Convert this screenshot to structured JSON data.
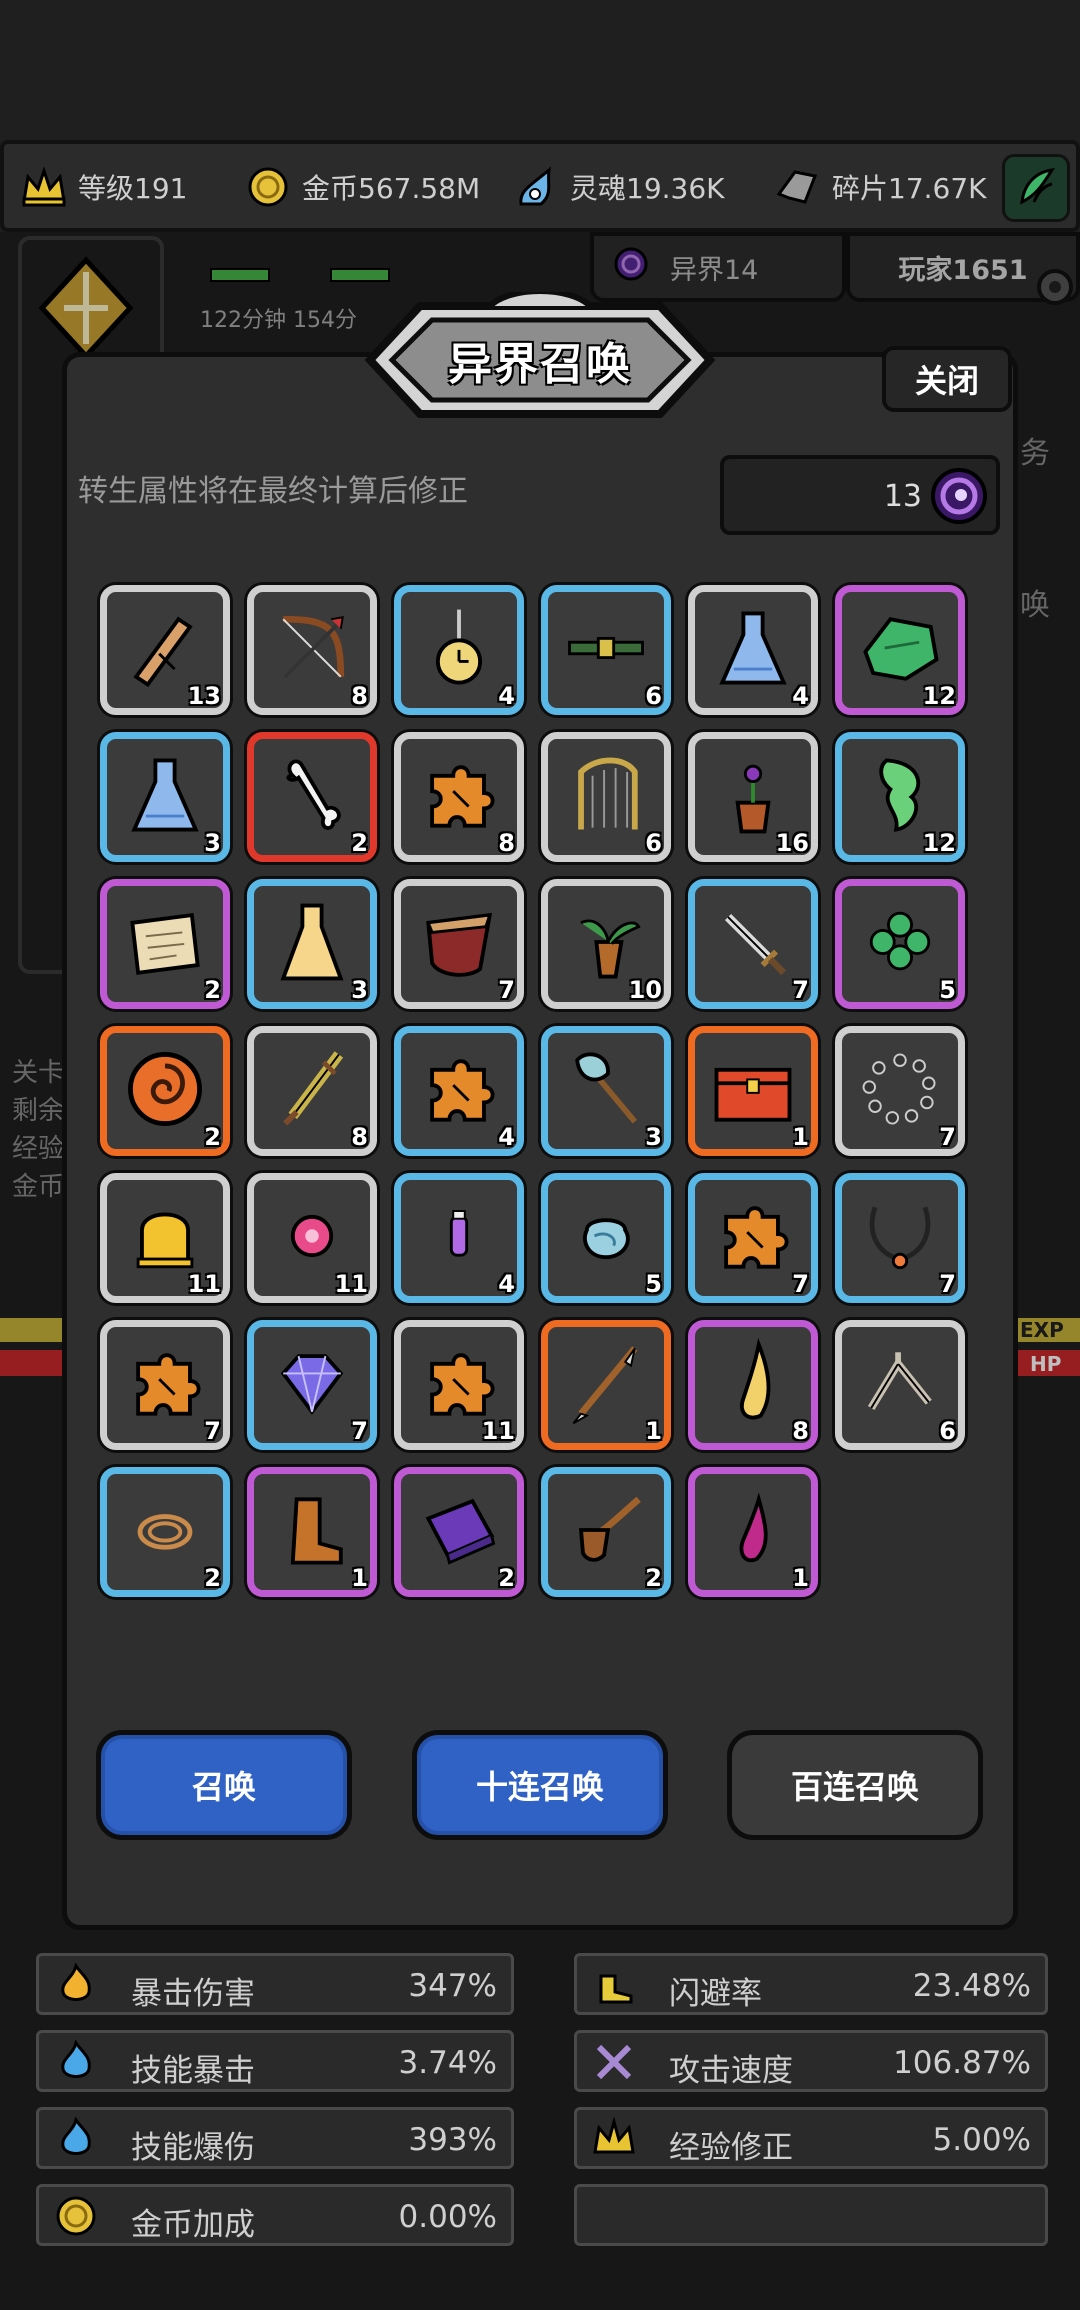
{
  "resources": [
    {
      "icon": "crown-icon",
      "label": "等级191"
    },
    {
      "icon": "coin-icon",
      "label": "金币567.58M"
    },
    {
      "icon": "soul-flame-icon",
      "label": "灵魂19.36K"
    },
    {
      "icon": "shard-icon",
      "label": "碎片17.67K"
    }
  ],
  "tabs": {
    "otherworld": "异界14",
    "player": "玩家1651"
  },
  "background": {
    "timer": "122分钟 154分",
    "right_chars": [
      "务",
      "唤"
    ],
    "left_lines": [
      "关卡",
      "剩余",
      "经验",
      "金币"
    ],
    "exp_label": "EXP",
    "hp_label": "HP"
  },
  "modal": {
    "title": "异界召唤",
    "close_label": "关闭",
    "notice": "转生属性将在最终计算后修正",
    "currency_value": "13",
    "buttons": {
      "summon": "召唤",
      "summon10": "十连召唤",
      "summon100": "百连召唤"
    }
  },
  "items": [
    {
      "name": "wooden-plank-icon",
      "rarity": "w",
      "count": "13"
    },
    {
      "name": "bow-icon",
      "rarity": "w",
      "count": "8"
    },
    {
      "name": "pocket-watch-icon",
      "rarity": "b",
      "count": "4"
    },
    {
      "name": "belt-icon",
      "rarity": "b",
      "count": "6"
    },
    {
      "name": "blue-potion-icon",
      "rarity": "w",
      "count": "4"
    },
    {
      "name": "green-cloth-icon",
      "rarity": "p",
      "count": "12"
    },
    {
      "name": "blue-potion-icon",
      "rarity": "b",
      "count": "3"
    },
    {
      "name": "bone-icon",
      "rarity": "r",
      "count": "2"
    },
    {
      "name": "puzzle-piece-icon",
      "rarity": "w",
      "count": "8"
    },
    {
      "name": "harp-icon",
      "rarity": "w",
      "count": "6"
    },
    {
      "name": "potted-plant-icon",
      "rarity": "w",
      "count": "16"
    },
    {
      "name": "green-leaf-icon",
      "rarity": "b",
      "count": "12"
    },
    {
      "name": "scroll-icon",
      "rarity": "p",
      "count": "2"
    },
    {
      "name": "yellow-potion-icon",
      "rarity": "b",
      "count": "3"
    },
    {
      "name": "red-cape-icon",
      "rarity": "w",
      "count": "7"
    },
    {
      "name": "herb-root-icon",
      "rarity": "w",
      "count": "10"
    },
    {
      "name": "dagger-icon",
      "rarity": "b",
      "count": "7"
    },
    {
      "name": "clover-icon",
      "rarity": "p",
      "count": "5"
    },
    {
      "name": "orange-swirl-icon",
      "rarity": "o",
      "count": "2"
    },
    {
      "name": "feather-sword-icon",
      "rarity": "w",
      "count": "8"
    },
    {
      "name": "puzzle-piece-icon",
      "rarity": "b",
      "count": "4"
    },
    {
      "name": "axe-icon",
      "rarity": "b",
      "count": "3"
    },
    {
      "name": "treasure-chest-icon",
      "rarity": "o",
      "count": "1"
    },
    {
      "name": "bead-necklace-icon",
      "rarity": "w",
      "count": "7"
    },
    {
      "name": "bell-icon",
      "rarity": "w",
      "count": "11"
    },
    {
      "name": "pink-orb-icon",
      "rarity": "w",
      "count": "11"
    },
    {
      "name": "purple-vial-icon",
      "rarity": "b",
      "count": "4"
    },
    {
      "name": "blue-stone-icon",
      "rarity": "b",
      "count": "5"
    },
    {
      "name": "puzzle-piece-icon",
      "rarity": "b",
      "count": "7"
    },
    {
      "name": "pendant-necklace-icon",
      "rarity": "b",
      "count": "7"
    },
    {
      "name": "puzzle-piece-icon",
      "rarity": "w",
      "count": "7"
    },
    {
      "name": "diamond-icon",
      "rarity": "b",
      "count": "7"
    },
    {
      "name": "puzzle-piece-icon",
      "rarity": "w",
      "count": "11"
    },
    {
      "name": "spear-icon",
      "rarity": "o",
      "count": "1"
    },
    {
      "name": "yellow-tooth-icon",
      "rarity": "p",
      "count": "8"
    },
    {
      "name": "slingshot-icon",
      "rarity": "w",
      "count": "6"
    },
    {
      "name": "rope-coil-icon",
      "rarity": "b",
      "count": "2"
    },
    {
      "name": "boot-icon",
      "rarity": "p",
      "count": "1"
    },
    {
      "name": "purple-book-icon",
      "rarity": "p",
      "count": "2"
    },
    {
      "name": "pipe-icon",
      "rarity": "b",
      "count": "2"
    },
    {
      "name": "pink-drop-icon",
      "rarity": "p",
      "count": "1"
    }
  ],
  "stats_left": [
    {
      "icon": "flame-icon",
      "label": "暴击伤害",
      "value": "347%"
    },
    {
      "icon": "blue-flame-icon",
      "label": "技能暴击",
      "value": "3.74%"
    },
    {
      "icon": "blue-flame-icon",
      "label": "技能爆伤",
      "value": "393%"
    },
    {
      "icon": "coin-icon",
      "label": "金币加成",
      "value": "0.00%"
    }
  ],
  "stats_right": [
    {
      "icon": "winged-boot-icon",
      "label": "闪避率",
      "value": "23.48%"
    },
    {
      "icon": "crossed-swords-icon",
      "label": "攻击速度",
      "value": "106.87%"
    },
    {
      "icon": "crown-icon",
      "label": "经验修正",
      "value": "5.00%"
    },
    {
      "icon": "",
      "label": "",
      "value": ""
    }
  ],
  "colors": {
    "rarity_white": "#cfcfcf",
    "rarity_blue": "#5ab8e6",
    "rarity_purple": "#c05ad4",
    "rarity_red": "#e0392c",
    "rarity_orange": "#f06b22",
    "button_blue": "#2f62c4"
  }
}
